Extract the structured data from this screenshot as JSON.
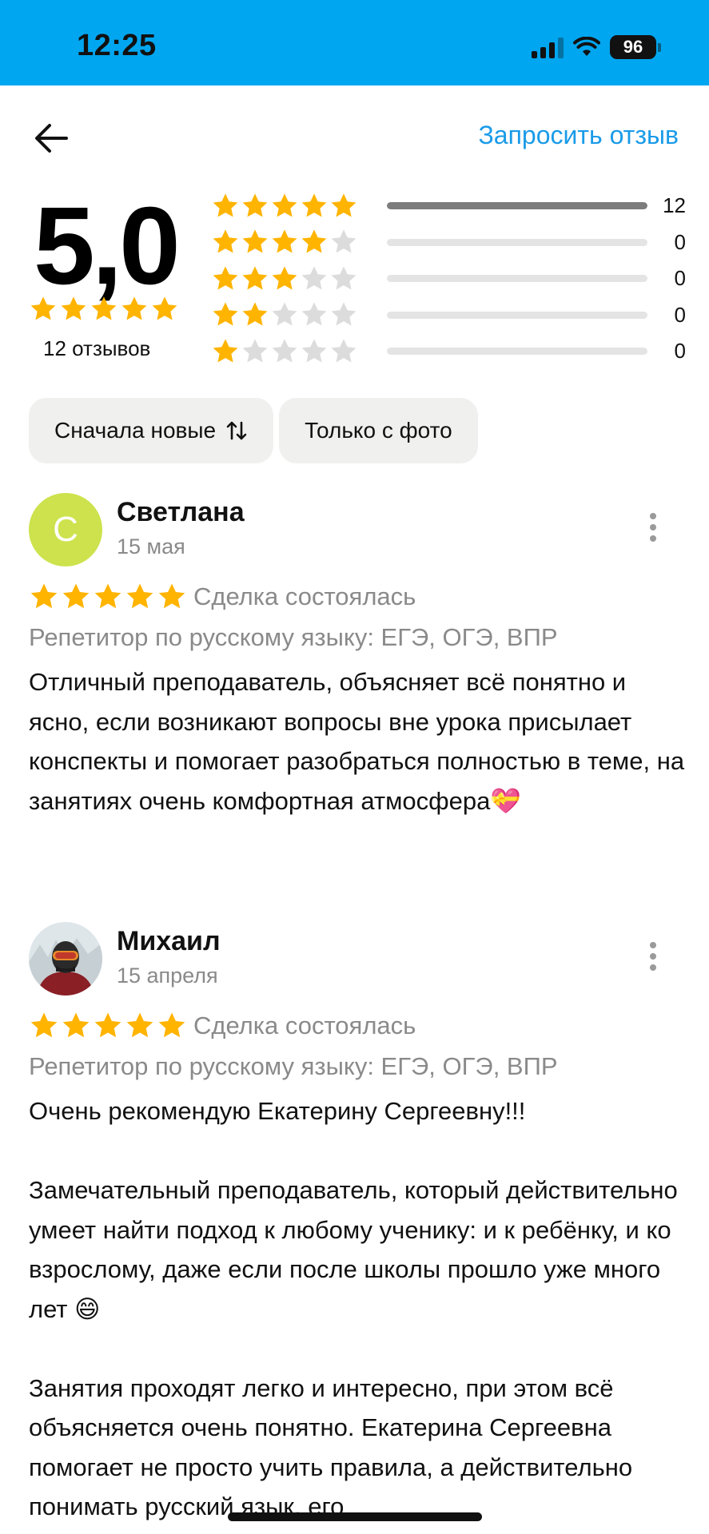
{
  "status_bar": {
    "time": "12:25",
    "battery": "96"
  },
  "nav": {
    "request_review": "Запросить отзыв"
  },
  "summary": {
    "rating": "5,0",
    "reviews_count": "12 отзывов",
    "distribution": [
      {
        "stars": 5,
        "count": "12",
        "fraction": 1.0
      },
      {
        "stars": 4,
        "count": "0",
        "fraction": 0
      },
      {
        "stars": 3,
        "count": "0",
        "fraction": 0
      },
      {
        "stars": 2,
        "count": "0",
        "fraction": 0
      },
      {
        "stars": 1,
        "count": "0",
        "fraction": 0
      }
    ]
  },
  "filters": {
    "sort": "Сначала новые",
    "photo_only": "Только с фото"
  },
  "reviews": [
    {
      "avatar_letter": "С",
      "author": "Светлана",
      "date": "15 мая",
      "stars": 5,
      "deal": "Сделка состоялась",
      "service": "Репетитор по русскому языку: ЕГЭ, ОГЭ, ВПР",
      "paragraphs": [
        "Отличный преподаватель, объясняет всё понятно и ясно, если возникают вопросы вне урока присылает конспекты и помогает разобраться полностью в теме, на занятиях очень комфортная атмосфера💝"
      ]
    },
    {
      "author": "Михаил",
      "date": "15 апреля",
      "stars": 5,
      "deal": "Сделка состоялась",
      "service": "Репетитор по русскому языку: ЕГЭ, ОГЭ, ВПР",
      "paragraphs": [
        "Очень рекомендую Екатерину Сергеевну!!!",
        "Замечательный преподаватель, который действительно умеет найти подход к любому ученику: и к ребёнку, и ко взрослому, даже если после школы прошло уже много лет 😄",
        "Занятия проходят легко и интересно, при этом всё объясняется очень понятно. Екатерина Сергеевна помогает не просто учить правила, а действительно понимать русский язык, его"
      ]
    }
  ],
  "colors": {
    "status_bar": "#00a6f0",
    "link": "#1a9be8",
    "star_on": "#ffb400",
    "star_off": "#dcdcdc",
    "avatar_bg": "#cde24c"
  },
  "icons": [
    "back-arrow-icon",
    "sort-icon",
    "more-vertical-icon",
    "signal-icon",
    "wifi-icon",
    "battery-icon",
    "star-icon"
  ]
}
